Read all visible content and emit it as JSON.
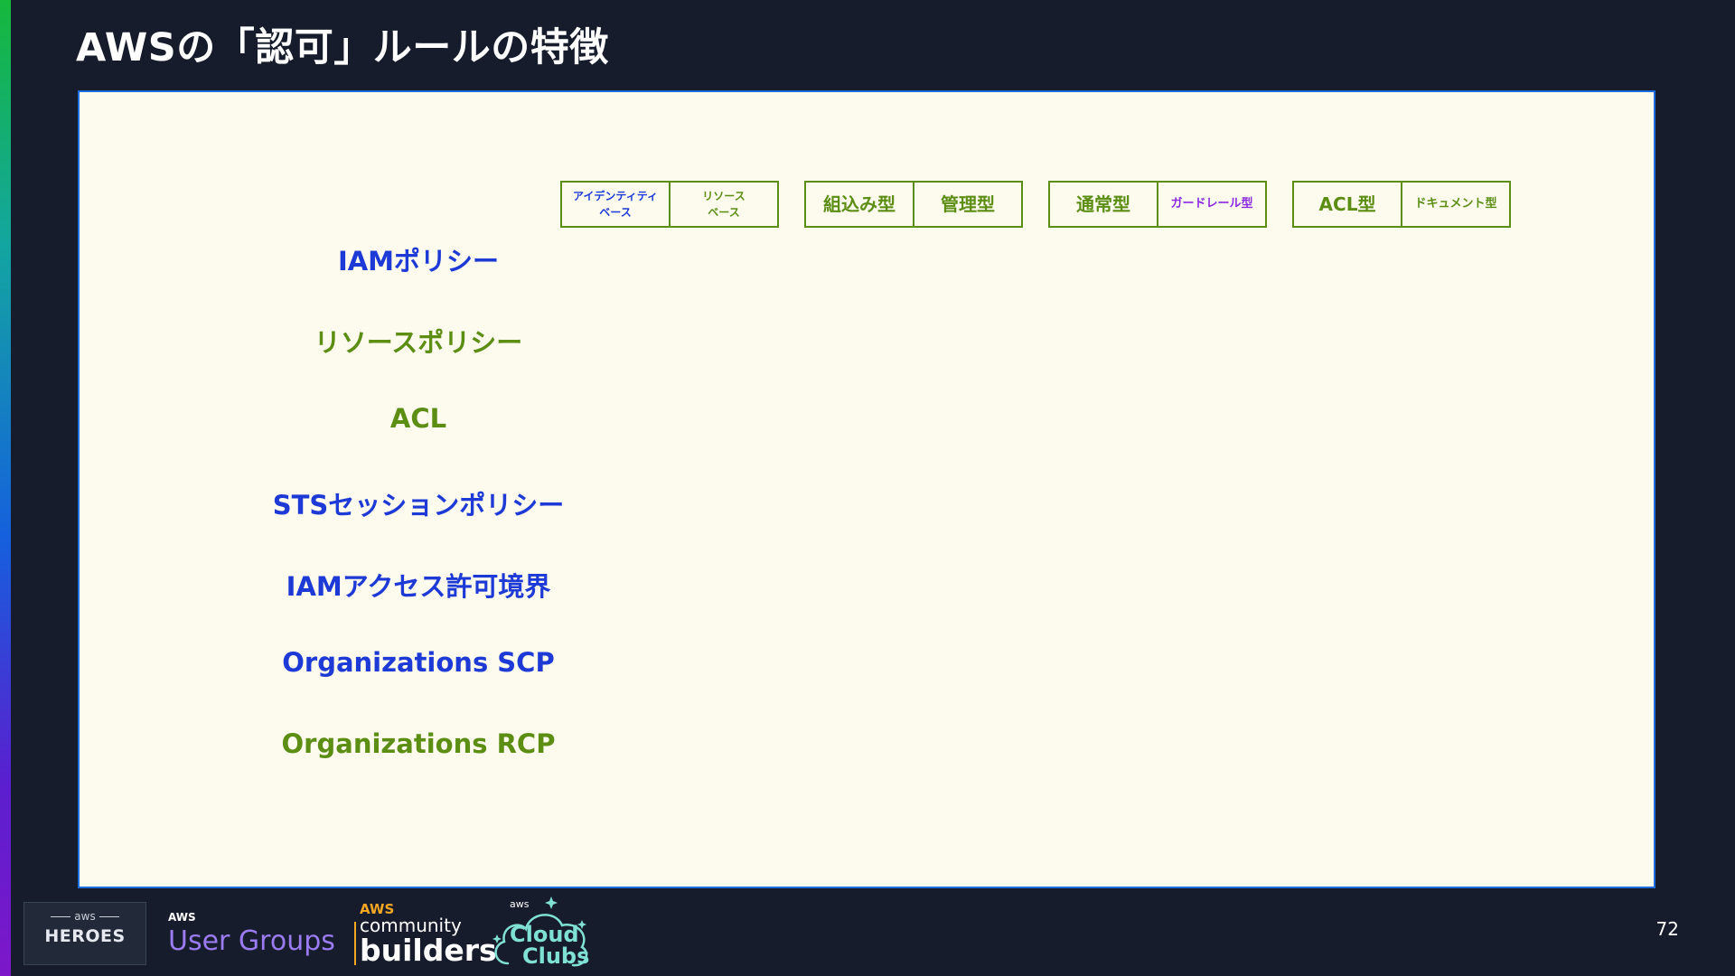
{
  "slide": {
    "title": "AWSの「認可」ルールの特徴",
    "page_number": "72"
  },
  "policies": [
    {
      "label": "IAMポリシー",
      "color": "#1d3ad6"
    },
    {
      "label": "リソースポリシー",
      "color": "#5c8e14"
    },
    {
      "label": "ACL",
      "color": "#5c8e14"
    },
    {
      "label": "STSセッションポリシー",
      "color": "#1d3ad6"
    },
    {
      "label": "IAMアクセス許可境界",
      "color": "#1d3ad6"
    },
    {
      "label": "Organizations SCP",
      "color": "#1d3ad6"
    },
    {
      "label": "Organizations RCP",
      "color": "#5c8e14"
    }
  ],
  "tag_groups": [
    {
      "left": "アイデンティティ\nベース",
      "right": "リソース\nベース"
    },
    {
      "left": "組込み型",
      "right": "管理型"
    },
    {
      "left": "通常型",
      "right": "ガードレール型"
    },
    {
      "left": "ACL型",
      "right": "ドキュメント型"
    }
  ],
  "footer": {
    "heroes_aws": "aws",
    "heroes": "HEROES",
    "user_groups_aws": "AWS",
    "user_groups": "User Groups",
    "community_aws": "AWS",
    "community": "community",
    "builders": "builders",
    "cloud_clubs_aws": "aws",
    "cloud": "Cloud",
    "clubs": "Clubs"
  },
  "colors": {
    "background": "#161c2b",
    "panel": "#fdfaee",
    "panel_border": "#1c6ee0",
    "blue": "#1d3ad6",
    "green": "#5c8e14",
    "purple": "#8a2be2"
  }
}
